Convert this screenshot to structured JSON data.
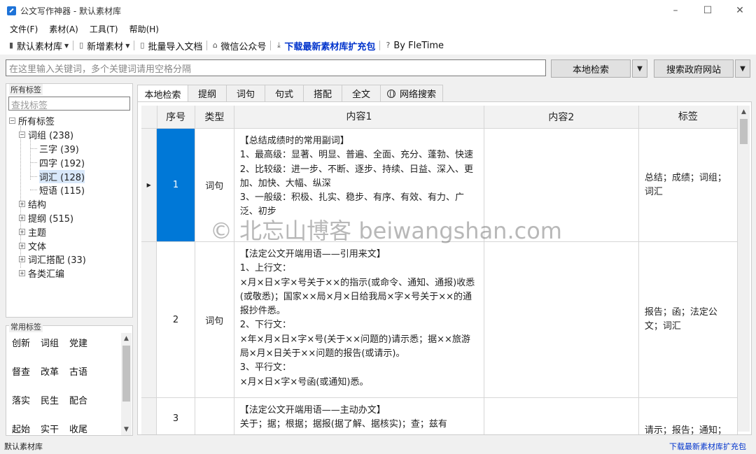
{
  "window": {
    "title": "公文写作神器 - 默认素材库",
    "minimize": "–",
    "maximize": "☐",
    "close": "✕"
  },
  "menu": [
    "文件(F)",
    "素材(A)",
    "工具(T)",
    "帮助(H)"
  ],
  "toolbar": {
    "library": "默认素材库",
    "add": "新增素材",
    "batch_import": "批量导入文档",
    "wechat": "微信公众号",
    "download": "下载最新素材库扩充包",
    "by": "By FleTime"
  },
  "search": {
    "placeholder": "在这里输入关键词，多个关键词请用空格分隔",
    "local_button": "本地检索",
    "gov_button": "搜索政府网站"
  },
  "all_tags": {
    "label": "所有标签",
    "search_placeholder": "查找标签",
    "root": "所有标签",
    "nodes": {
      "cizu": "词组 (238)",
      "sanzi": "三字 (39)",
      "sizi": "四字 (192)",
      "cihui": "词汇 (128)",
      "duanyu": "短语 (115)",
      "jiegou": "结构",
      "tigang": "提纲 (515)",
      "zhuti": "主题",
      "wenti": "文体",
      "cihuidapei": "词汇搭配 (33)",
      "gelei": "各类汇编"
    }
  },
  "common_tags": {
    "label": "常用标签",
    "rows": [
      [
        "创新",
        "词组",
        "党建"
      ],
      [
        "督查",
        "改革",
        "古语"
      ],
      [
        "落实",
        "民生",
        "配合"
      ],
      [
        "起始",
        "实干",
        "收尾"
      ]
    ]
  },
  "tabs": [
    "本地检索",
    "提纲",
    "词句",
    "句式",
    "搭配",
    "全文",
    "网络搜索"
  ],
  "table": {
    "headers": [
      "序号",
      "类型",
      "内容1",
      "内容2",
      "标签"
    ],
    "rows": [
      {
        "index": "1",
        "type": "词句",
        "content1": "【总结成绩时的常用副词】\n1、最高级：显著、明显、普遍、全面、充分、蓬勃、快速\n2、比较级：进一步、不断、逐步、持续、日益、深入、更加、加快、大幅、纵深\n3、一般级：积极、扎实、稳步、有序、有效、有力、广泛、初步",
        "content2": "",
        "tags": "总结；成绩；词组；词汇"
      },
      {
        "index": "2",
        "type": "词句",
        "content1": "【法定公文开端用语——引用来文】\n1、上行文：\n×月×日×字×号关于××的指示(或命令、通知、通报)收悉(或敬悉)；国家××局×月×日给我局×字×号关于××的通报抄件悉。\n2、下行文：\n×年×月×日×字×号(关于××问题的)请示悉；据××旅游局×月×日关于××问题的报告(或请示)。\n3、平行文：\n×月×日×字×号函(或通知)悉。",
        "content2": "",
        "tags": "报告；函；法定公文；词汇"
      },
      {
        "index": "3",
        "type": "",
        "content1": "【法定公文开端用语——主动办文】\n关于；据；根据；据报(据了解、据核实)；查；兹有",
        "content2": "",
        "tags": "请示；报告；通知；"
      }
    ]
  },
  "watermark": "© 北忘山博客 beiwangshan.com",
  "status": {
    "left": "默认素材库",
    "right": "下载最新素材库扩充包"
  }
}
